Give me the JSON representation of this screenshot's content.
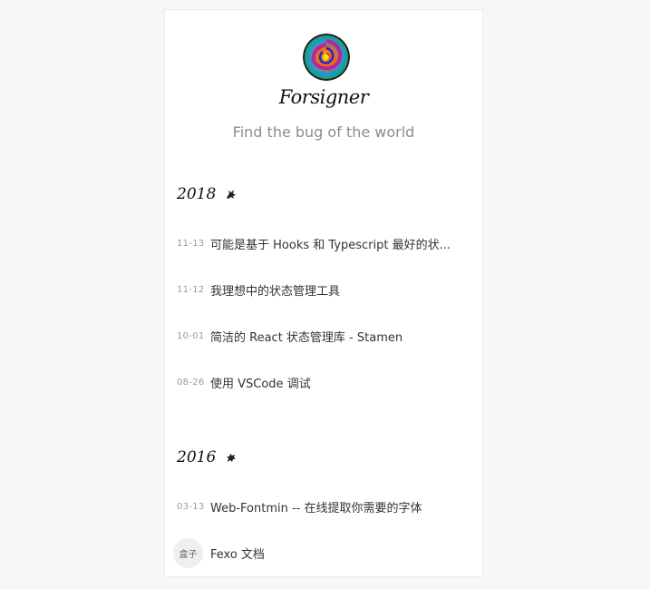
{
  "header": {
    "site_title": "Forsigner",
    "tagline": "Find the bug of the world"
  },
  "archive": [
    {
      "year": "2018",
      "year_icon": "dragon-icon",
      "posts": [
        {
          "date": "11-13",
          "title": "可能是基于 Hooks 和 Typescript 最好的状..."
        },
        {
          "date": "11-12",
          "title": "我理想中的状态管理工具"
        },
        {
          "date": "10-01",
          "title": "简洁的 React 状态管理库 - Stamen"
        },
        {
          "date": "08-26",
          "title": "使用 VSCode 调试"
        }
      ]
    },
    {
      "year": "2016",
      "year_icon": "monkey-icon",
      "posts": [
        {
          "date": "03-13",
          "title": "Web-Fontmin -- 在线提取你需要的字体"
        },
        {
          "badge": "盒子",
          "title": "Fexo 文档"
        }
      ]
    }
  ],
  "colors": {
    "page_bg": "#f7f7f7",
    "card_bg": "#ffffff",
    "text": "#333333",
    "muted": "#9b9b9b"
  }
}
